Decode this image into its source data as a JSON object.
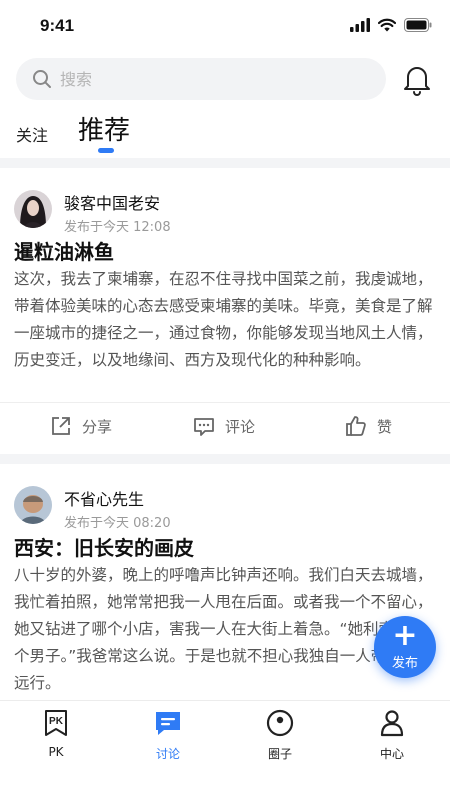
{
  "status_bar": {
    "time": "9:41"
  },
  "search": {
    "placeholder": "搜索"
  },
  "tabs": [
    {
      "label": "关注",
      "active": false
    },
    {
      "label": "推荐",
      "active": true
    }
  ],
  "posts": [
    {
      "author": "骏客中国老安",
      "time": "发布于今天 12:08",
      "title": "暹粒油淋鱼",
      "body": "这次，我去了柬埔寨，在忍不住寻找中国菜之前，我虔诚地，带着体验美味的心态去感受柬埔寨的美味。毕竟，美食是了解一座城市的捷径之一，通过食物，你能够发现当地风土人情，历史变迁，以及地缘间、西方及现代化的种种影响。"
    },
    {
      "author": "不省心先生",
      "time": "发布于今天 08:20",
      "title": "西安：旧长安的画皮",
      "body": "八十岁的外婆，晚上的呼噜声比钟声还响。我们白天去城墙，我忙着拍照，她常常把我一人甩在后面。或者我一个不留心，她又钻进了哪个小店，害我一人在大街上着急。“她利索得像个男子。”我爸常这么说。于是也就不担心我独自一人带她出门远行。"
    }
  ],
  "actions": {
    "share": "分享",
    "comment": "评论",
    "like": "赞"
  },
  "fab": {
    "label": "发布"
  },
  "nav": [
    {
      "label": "PK",
      "icon": "pk-icon",
      "active": false
    },
    {
      "label": "讨论",
      "icon": "chat-icon",
      "active": true
    },
    {
      "label": "圈子",
      "icon": "circle-icon",
      "active": false
    },
    {
      "label": "中心",
      "icon": "user-icon",
      "active": false
    }
  ],
  "colors": {
    "accent": "#2f7bf5",
    "gap": "#f3f4f6",
    "muted": "#9a9a9a"
  }
}
